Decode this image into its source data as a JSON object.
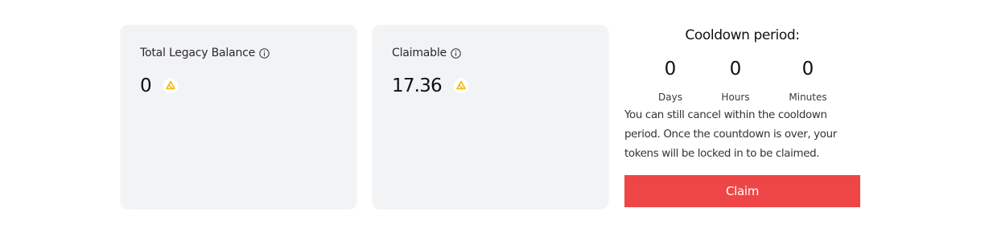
{
  "cards": {
    "legacy": {
      "label": "Total Legacy Balance",
      "value": "0",
      "info_icon": "info-circle-icon",
      "token_icon": "token-logo-icon"
    },
    "claimable": {
      "label": "Claimable",
      "value": "17.36",
      "info_icon": "info-circle-icon",
      "token_icon": "token-logo-icon"
    }
  },
  "cooldown": {
    "title": "Cooldown period:",
    "units": [
      {
        "value": "0",
        "label": "Days"
      },
      {
        "value": "0",
        "label": "Hours"
      },
      {
        "value": "0",
        "label": "Minutes"
      }
    ],
    "note": "You can still cancel within the cooldown period. Once the countdown is over, your tokens will be locked in to be claimed.",
    "claim_label": "Claim"
  },
  "colors": {
    "card_background": "#f2f3f5",
    "claim_button": "#ee4646",
    "token_icon": "#f2b705"
  }
}
